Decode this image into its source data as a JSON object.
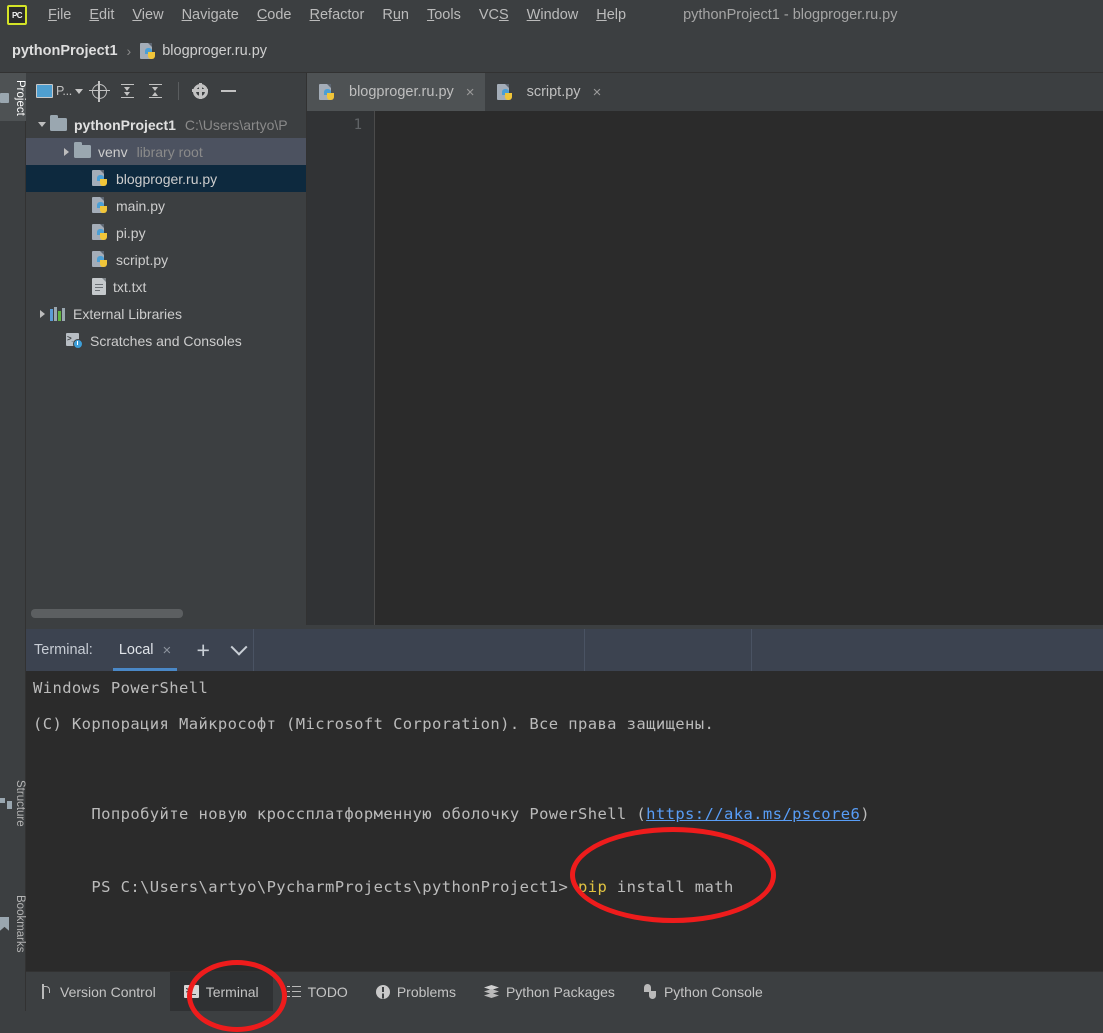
{
  "window": {
    "title": "pythonProject1 - blogproger.ru.py",
    "logo_text": "PC"
  },
  "menubar": {
    "items": [
      {
        "label": "File",
        "mnemonic": "F"
      },
      {
        "label": "Edit",
        "mnemonic": "E"
      },
      {
        "label": "View",
        "mnemonic": "V"
      },
      {
        "label": "Navigate",
        "mnemonic": "N"
      },
      {
        "label": "Code",
        "mnemonic": "C"
      },
      {
        "label": "Refactor",
        "mnemonic": "R"
      },
      {
        "label": "Run",
        "mnemonic": "u"
      },
      {
        "label": "Tools",
        "mnemonic": "T"
      },
      {
        "label": "VCS",
        "mnemonic": "S"
      },
      {
        "label": "Window",
        "mnemonic": "W"
      },
      {
        "label": "Help",
        "mnemonic": "H"
      }
    ]
  },
  "breadcrumb": {
    "project": "pythonProject1",
    "separator": "›",
    "file": "blogproger.ru.py"
  },
  "tool_stripe": {
    "project": "Project",
    "structure": "Structure",
    "bookmarks": "Bookmarks"
  },
  "project_panel": {
    "toolbar": {
      "view_label": "P...",
      "icons": [
        "project-view-icon",
        "locate-icon",
        "expand-all-icon",
        "collapse-all-icon",
        "settings-gear-icon",
        "hide-icon"
      ]
    },
    "tree": [
      {
        "label": "pythonProject1",
        "secondary": "C:\\Users\\artyo\\P",
        "icon": "folder-icon",
        "indent": 0,
        "arrow": "down",
        "bold": true,
        "state": "normal"
      },
      {
        "label": "venv",
        "secondary": "library root",
        "icon": "folder-icon",
        "indent": 1,
        "arrow": "right",
        "bold": false,
        "state": "hovered"
      },
      {
        "label": "blogproger.ru.py",
        "secondary": "",
        "icon": "python-file-icon",
        "indent": 2,
        "arrow": "none",
        "bold": false,
        "state": "selected"
      },
      {
        "label": "main.py",
        "secondary": "",
        "icon": "python-file-icon",
        "indent": 2,
        "arrow": "none",
        "bold": false,
        "state": "normal"
      },
      {
        "label": "pi.py",
        "secondary": "",
        "icon": "python-file-icon",
        "indent": 2,
        "arrow": "none",
        "bold": false,
        "state": "normal"
      },
      {
        "label": "script.py",
        "secondary": "",
        "icon": "python-file-icon",
        "indent": 2,
        "arrow": "none",
        "bold": false,
        "state": "normal"
      },
      {
        "label": "txt.txt",
        "secondary": "",
        "icon": "text-file-icon",
        "indent": 2,
        "arrow": "none",
        "bold": false,
        "state": "normal"
      },
      {
        "label": "External Libraries",
        "secondary": "",
        "icon": "libraries-icon",
        "indent": 0,
        "arrow": "right",
        "bold": false,
        "state": "normal"
      },
      {
        "label": "Scratches and Consoles",
        "secondary": "",
        "icon": "scratches-icon",
        "indent": 1,
        "arrow": "none",
        "bold": false,
        "state": "normal"
      }
    ]
  },
  "editor": {
    "tabs": [
      {
        "label": "blogproger.ru.py",
        "icon": "python-file-icon",
        "active": true,
        "close": "×"
      },
      {
        "label": "script.py",
        "icon": "python-file-icon",
        "active": false,
        "close": "×"
      }
    ],
    "line_numbers": [
      "1"
    ],
    "content": ""
  },
  "terminal_header": {
    "label": "Terminal:",
    "tab": "Local",
    "tab_close": "×",
    "new_session": "+",
    "dropdown": "chevron-down-icon"
  },
  "terminal": {
    "lines": [
      {
        "id": "l1",
        "text": "Windows PowerShell",
        "type": "plain"
      },
      {
        "id": "l2",
        "text": "(C) Корпорация Майкрософт (Microsoft Corporation). Все права защищены.",
        "type": "plain"
      },
      {
        "id": "l3",
        "pre": "Попробуйте новую кроссплатформенную оболочку PowerShell (",
        "link": "https://aka.ms/pscore6",
        "post": ")",
        "type": "link"
      }
    ],
    "prompt": "PS C:\\Users\\artyo\\PycharmProjects\\pythonProject1>",
    "command_cmd": "pip",
    "command_args": " install math"
  },
  "bottom_bar": {
    "items": [
      {
        "label": "Version Control",
        "icon": "branch-icon",
        "active": false
      },
      {
        "label": "Terminal",
        "icon": "terminal-icon",
        "active": true
      },
      {
        "label": "TODO",
        "icon": "todo-list-icon",
        "active": false
      },
      {
        "label": "Problems",
        "icon": "problems-icon",
        "active": false
      },
      {
        "label": "Python Packages",
        "icon": "packages-icon",
        "active": false
      },
      {
        "label": "Python Console",
        "icon": "python-console-icon",
        "active": false
      }
    ]
  },
  "annotations": [
    {
      "name": "command-highlight",
      "target": "pip install math"
    },
    {
      "name": "terminal-tab-highlight",
      "target": "Terminal"
    }
  ],
  "colors": {
    "chrome": "#3c3f41",
    "editor_bg": "#2b2b2b",
    "terminal_header": "#3c4350",
    "selection": "#0d293e",
    "hover": "#4c5260",
    "accent_blue": "#4a88c7",
    "annotation_red": "#ee1c1c",
    "link_blue": "#589df6",
    "cmd_yellow": "#e0c341"
  }
}
